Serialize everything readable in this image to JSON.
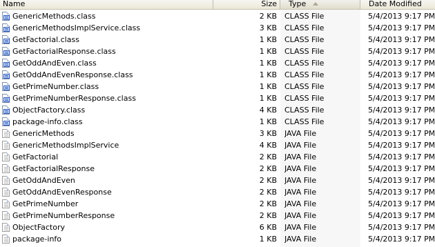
{
  "columns": {
    "name": "Name",
    "size": "Size",
    "type": "Type",
    "date": "Date Modified",
    "sorted_by": "Type",
    "sort_direction": "ascending"
  },
  "files": [
    {
      "name": "GenericMethods.class",
      "size": "2 KB",
      "type": "CLASS File",
      "date": "5/4/2013 9:17 PM",
      "icon": "class-file-icon"
    },
    {
      "name": "GenericMethodsImplService.class",
      "size": "3 KB",
      "type": "CLASS File",
      "date": "5/4/2013 9:17 PM",
      "icon": "class-file-icon"
    },
    {
      "name": "GetFactorial.class",
      "size": "1 KB",
      "type": "CLASS File",
      "date": "5/4/2013 9:17 PM",
      "icon": "class-file-icon"
    },
    {
      "name": "GetFactorialResponse.class",
      "size": "1 KB",
      "type": "CLASS File",
      "date": "5/4/2013 9:17 PM",
      "icon": "class-file-icon"
    },
    {
      "name": "GetOddAndEven.class",
      "size": "1 KB",
      "type": "CLASS File",
      "date": "5/4/2013 9:17 PM",
      "icon": "class-file-icon"
    },
    {
      "name": "GetOddAndEvenResponse.class",
      "size": "1 KB",
      "type": "CLASS File",
      "date": "5/4/2013 9:17 PM",
      "icon": "class-file-icon"
    },
    {
      "name": "GetPrimeNumber.class",
      "size": "1 KB",
      "type": "CLASS File",
      "date": "5/4/2013 9:17 PM",
      "icon": "class-file-icon"
    },
    {
      "name": "GetPrimeNumberResponse.class",
      "size": "1 KB",
      "type": "CLASS File",
      "date": "5/4/2013 9:17 PM",
      "icon": "class-file-icon"
    },
    {
      "name": "ObjectFactory.class",
      "size": "4 KB",
      "type": "CLASS File",
      "date": "5/4/2013 9:17 PM",
      "icon": "class-file-icon"
    },
    {
      "name": "package-info.class",
      "size": "1 KB",
      "type": "CLASS File",
      "date": "5/4/2013 9:17 PM",
      "icon": "class-file-icon"
    },
    {
      "name": "GenericMethods",
      "size": "3 KB",
      "type": "JAVA File",
      "date": "5/4/2013 9:17 PM",
      "icon": "java-file-icon"
    },
    {
      "name": "GenericMethodsImplService",
      "size": "4 KB",
      "type": "JAVA File",
      "date": "5/4/2013 9:17 PM",
      "icon": "java-file-icon"
    },
    {
      "name": "GetFactorial",
      "size": "2 KB",
      "type": "JAVA File",
      "date": "5/4/2013 9:17 PM",
      "icon": "java-file-icon"
    },
    {
      "name": "GetFactorialResponse",
      "size": "2 KB",
      "type": "JAVA File",
      "date": "5/4/2013 9:17 PM",
      "icon": "java-file-icon"
    },
    {
      "name": "GetOddAndEven",
      "size": "2 KB",
      "type": "JAVA File",
      "date": "5/4/2013 9:17 PM",
      "icon": "java-file-icon"
    },
    {
      "name": "GetOddAndEvenResponse",
      "size": "2 KB",
      "type": "JAVA File",
      "date": "5/4/2013 9:17 PM",
      "icon": "java-file-icon"
    },
    {
      "name": "GetPrimeNumber",
      "size": "2 KB",
      "type": "JAVA File",
      "date": "5/4/2013 9:17 PM",
      "icon": "java-file-icon"
    },
    {
      "name": "GetPrimeNumberResponse",
      "size": "2 KB",
      "type": "JAVA File",
      "date": "5/4/2013 9:17 PM",
      "icon": "java-file-icon"
    },
    {
      "name": "ObjectFactory",
      "size": "6 KB",
      "type": "JAVA File",
      "date": "5/4/2013 9:17 PM",
      "icon": "java-file-icon"
    },
    {
      "name": "package-info",
      "size": "1 KB",
      "type": "JAVA File",
      "date": "5/4/2013 9:17 PM",
      "icon": "java-file-icon"
    }
  ]
}
